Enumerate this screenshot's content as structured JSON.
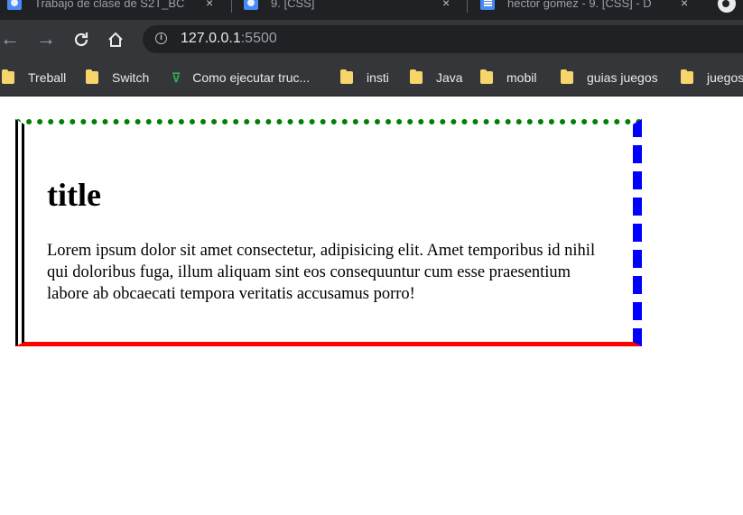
{
  "browser": {
    "tabs": [
      {
        "title": "Trabajo de clase de S2T_BC",
        "close": "×"
      },
      {
        "title": "9. [CSS]",
        "close": "×"
      },
      {
        "title": "hector gomez - 9. [CSS] - D",
        "close": "×"
      }
    ],
    "address": {
      "host": "127.0.0.1",
      "port": ":5500"
    },
    "bookmarks": [
      {
        "label": "Treball",
        "icon": "folder-icon"
      },
      {
        "label": "Switch",
        "icon": "folder-icon"
      },
      {
        "label": "Como ejecutar truc...",
        "icon": "vite-icon"
      },
      {
        "label": "insti",
        "icon": "folder-icon"
      },
      {
        "label": "Java",
        "icon": "folder-icon"
      },
      {
        "label": "mobil",
        "icon": "folder-icon"
      },
      {
        "label": "guias juegos",
        "icon": "folder-icon"
      },
      {
        "label": "juegos",
        "icon": "folder-icon"
      }
    ]
  },
  "page": {
    "title": "title",
    "body": "Lorem ipsum dolor sit amet consectetur, adipisicing elit. Amet temporibus id nihil qui doloribus fuga, illum aliquam sint eos consequuntur cum esse praesentium labore ab obcaecati tempora veritatis accusamus porro!"
  },
  "colors": {
    "border_top": "#008000",
    "border_right": "#0000ff",
    "border_bottom": "#ff0000",
    "border_left": "#000000"
  }
}
